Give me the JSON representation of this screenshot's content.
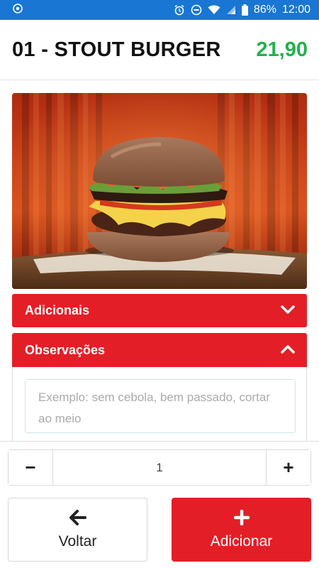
{
  "status_bar": {
    "battery": "86%",
    "time": "12:00",
    "color": "#1976d2"
  },
  "product": {
    "title": "01 - STOUT BURGER",
    "price": "21,90",
    "price_color": "#22b14c"
  },
  "sections": {
    "adicionais_label": "Adicionais",
    "observacoes_label": "Observações",
    "observacoes_placeholder": "Exemplo: sem cebola, bem passado, cortar ao meio",
    "accent_color": "#e41e26"
  },
  "quantity": {
    "minus": "−",
    "value": "1",
    "plus": "+"
  },
  "actions": {
    "back_label": "Voltar",
    "add_label": "Adicionar"
  },
  "icons": {
    "status_left": "location-pin-icon",
    "alarm": "alarm-icon",
    "dnd": "do-not-disturb-icon",
    "wifi": "wifi-icon",
    "signal": "signal-icon",
    "battery": "battery-icon",
    "adicionais_toggle": "chevron-down-icon",
    "observacoes_toggle": "chevron-up-icon",
    "back": "arrow-left-icon",
    "add": "plus-icon"
  }
}
